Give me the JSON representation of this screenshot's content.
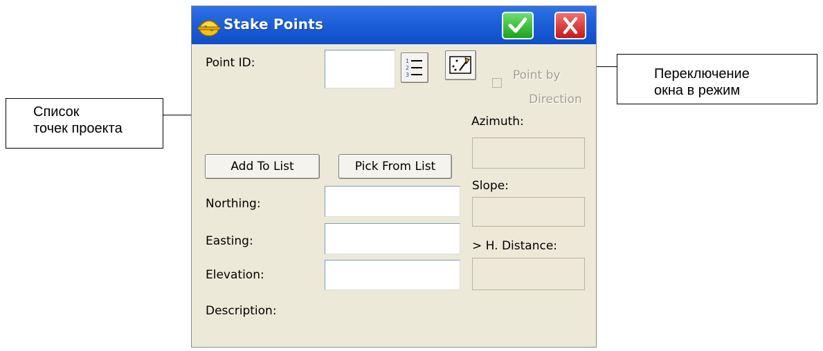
{
  "dialog": {
    "title": "Stake Points",
    "ok_icon": "checkmark-icon",
    "cancel_icon": "close-icon",
    "point_id_label": "Point ID:",
    "point_id_value": "",
    "list_icon": "numbered-list-icon",
    "map_icon": "map-view-icon",
    "point_by_direction_line1": "Point by",
    "point_by_direction_line2": "Direction",
    "point_by_direction_checked": false,
    "azimuth_label": "Azimuth:",
    "slope_label": "Slope:",
    "h_distance_label": "> H. Distance:",
    "add_to_list_label": "Add To List",
    "pick_from_list_label": "Pick From List",
    "northing_label": "Northing:",
    "easting_label": "Easting:",
    "elevation_label": "Elevation:",
    "description_label": "Description:",
    "northing_value": "",
    "easting_value": "",
    "elevation_value": ""
  },
  "callouts": {
    "left_line1": "Список",
    "left_line2": "точек проекта",
    "right_line1": "Переключение",
    "right_line2": "окна в режим"
  },
  "colors": {
    "titlebar": "#0e4fc8",
    "dialog_bg": "#ece9d8",
    "ok": "#1ca11c",
    "cancel": "#c81818"
  }
}
